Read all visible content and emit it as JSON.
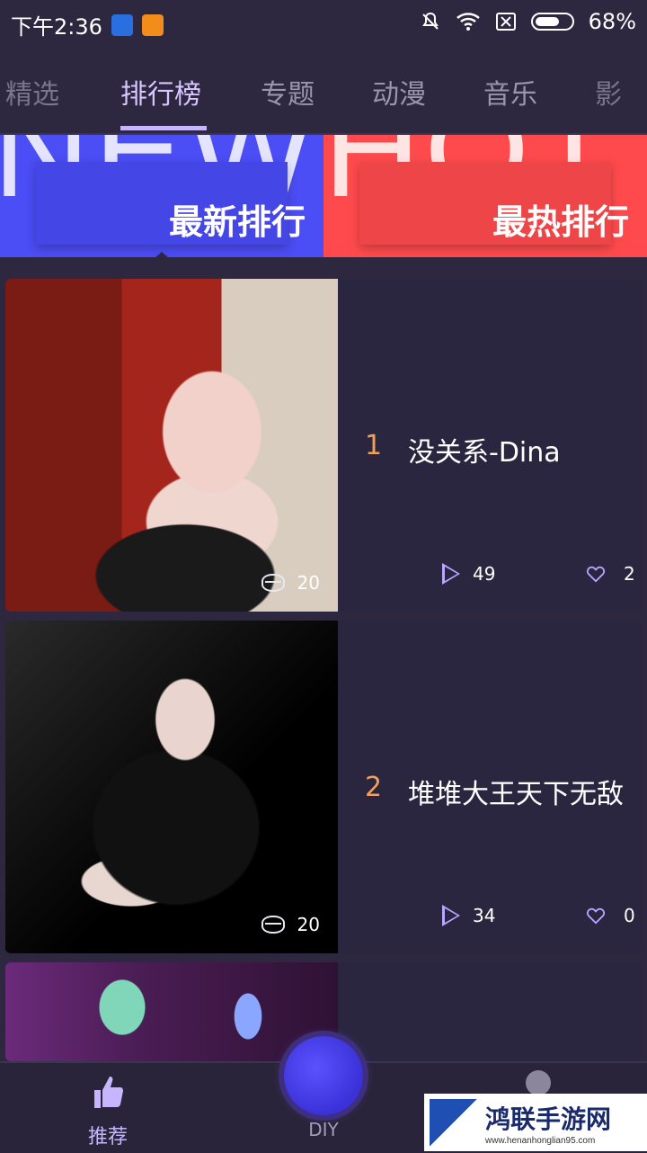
{
  "status_bar": {
    "time": "下午2:36",
    "battery": "68%",
    "battery_level": 0.68,
    "icons": [
      "shield-icon",
      "uc-browser-icon",
      "mute-icon",
      "wifi-icon",
      "sim-off-icon",
      "battery-icon"
    ]
  },
  "tabs": {
    "items": [
      "精选",
      "排行榜",
      "专题",
      "动漫",
      "音乐",
      "影"
    ],
    "active_index": 1
  },
  "banners": {
    "left": {
      "bg_text": "NEW",
      "label": "最新排行",
      "color": "#4b4df5"
    },
    "right": {
      "bg_text": "HOT",
      "label": "最热排行",
      "color": "#ff4a4d"
    }
  },
  "list": [
    {
      "rank": "1",
      "title": "没关系-Dina",
      "count": "20",
      "plays": "49",
      "likes": "2"
    },
    {
      "rank": "2",
      "title": "堆堆大王天下无敌",
      "count": "20",
      "plays": "34",
      "likes": "0"
    }
  ],
  "bottom_nav": {
    "recommend": "推荐",
    "diy": "DIY"
  },
  "watermark": {
    "main": "鸿联手游网",
    "url": "www.henanhonglian95.com"
  },
  "colors": {
    "background": "#2d2740",
    "accent": "#c7b6ff",
    "rank": "#f0a05a"
  }
}
